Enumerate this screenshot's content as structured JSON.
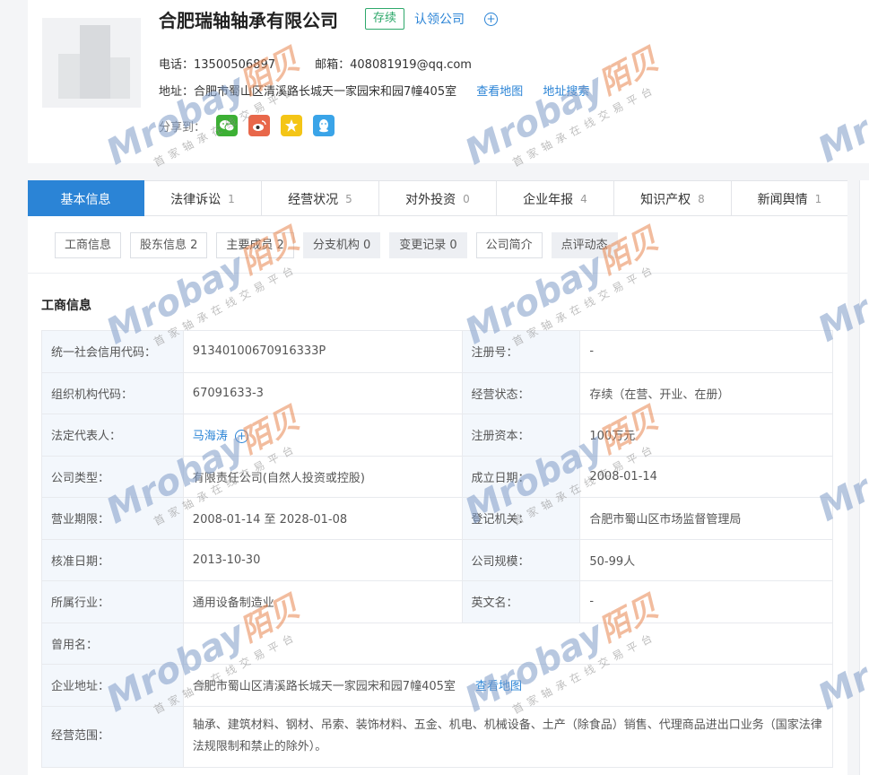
{
  "company": {
    "name": "合肥瑞轴轴承有限公司",
    "status": "存续",
    "claim": "认领公司"
  },
  "contact": {
    "phone": "电话：13500506897",
    "email": "邮箱：408081919@qq.com",
    "address": "地址：合肥市蜀山区清溪路长城天一家园宋和园7幢405室",
    "map_link": "查看地图",
    "addr_search": "地址搜索",
    "share_label": "分享到："
  },
  "share_icons": [
    "wechat-icon",
    "weibo-icon",
    "qzone-icon",
    "qq-icon"
  ],
  "tabs": [
    {
      "label": "基本信息",
      "count": ""
    },
    {
      "label": "法律诉讼",
      "count": "1"
    },
    {
      "label": "经营状况",
      "count": "5"
    },
    {
      "label": "对外投资",
      "count": "0"
    },
    {
      "label": "企业年报",
      "count": "4"
    },
    {
      "label": "知识产权",
      "count": "8"
    },
    {
      "label": "新闻舆情",
      "count": "1"
    }
  ],
  "subtabs": [
    "工商信息",
    "股东信息 2",
    "主要成员 2",
    "分支机构 0",
    "变更记录 0",
    "公司简介",
    "点评动态"
  ],
  "section_title": "工商信息",
  "info": {
    "credit_code_k": "统一社会信用代码：",
    "credit_code_v": "91340100670916333P",
    "reg_no_k": "注册号：",
    "reg_no_v": "-",
    "org_code_k": "组织机构代码：",
    "org_code_v": "67091633-3",
    "biz_status_k": "经营状态：",
    "biz_status_v": "存续（在营、开业、在册）",
    "legal_rep_k": "法定代表人：",
    "legal_rep_v": "马海涛",
    "capital_k": "注册资本：",
    "capital_v": "100万元",
    "type_k": "公司类型：",
    "type_v": "有限责任公司(自然人投资或控股)",
    "founded_k": "成立日期：",
    "founded_v": "2008-01-14",
    "term_k": "营业期限：",
    "term_v": "2008-01-14 至 2028-01-08",
    "authority_k": "登记机关：",
    "authority_v": "合肥市蜀山区市场监督管理局",
    "approved_k": "核准日期：",
    "approved_v": "2013-10-30",
    "scale_k": "公司规模：",
    "scale_v": "50-99人",
    "industry_k": "所属行业：",
    "industry_v": "通用设备制造业",
    "en_name_k": "英文名：",
    "en_name_v": "-",
    "former_k": "曾用名：",
    "former_v": "",
    "address_k": "企业地址：",
    "address_v": "合肥市蜀山区清溪路长城天一家园宋和园7幢405室",
    "address_link": "查看地图",
    "scope_k": "经营范围：",
    "scope_v": "轴承、建筑材料、钢材、吊索、装饰材料、五金、机电、机械设备、土产（除食品）销售、代理商品进出口业务（国家法律法规限制和禁止的除外）。"
  },
  "watermark": {
    "brand": "Mrobay",
    "brand_cn": "陌贝",
    "slogan": "首家轴承在线交易平台"
  },
  "colors": {
    "accent": "#2b84d6",
    "status_green": "#2ea86b",
    "wechat": "#3cb034",
    "weibo": "#e8674a",
    "qzone": "#f4c516",
    "qq": "#3aa4e8"
  }
}
